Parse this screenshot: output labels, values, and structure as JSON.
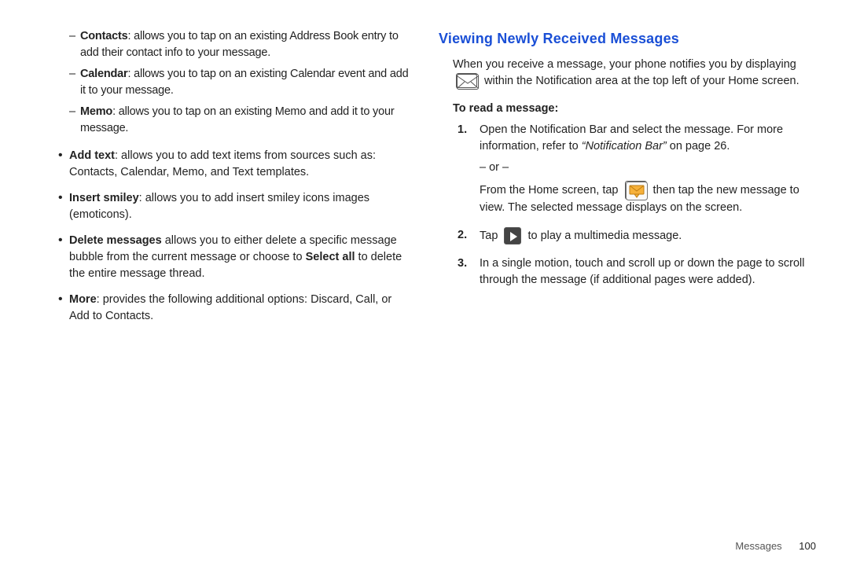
{
  "left": {
    "dash": [
      {
        "term": "Contacts",
        "text": ": allows you to tap on an existing Address Book entry to add their contact info to your message."
      },
      {
        "term": "Calendar",
        "text": ": allows you to tap on an existing Calendar event and add it to your message."
      },
      {
        "term": "Memo",
        "text": ": allows you to tap on an existing Memo and add it to your message."
      }
    ],
    "bullets": [
      {
        "term": "Add text",
        "text": ": allows you to add text items from sources such as: Contacts, Calendar, Memo, and Text templates."
      },
      {
        "term": "Insert smiley",
        "text": ": allows you to add insert smiley icons images (emoticons)."
      },
      {
        "term": "Delete messages",
        "pre": " allows you to either delete a specific message bubble from the current message or choose to ",
        "term2": "Select all",
        "text": " to delete the entire message thread."
      },
      {
        "term": "More",
        "text": ": provides the following additional options: Discard, Call, or Add to Contacts."
      }
    ]
  },
  "right": {
    "section_title": "Viewing Newly Received Messages",
    "intro_pre": "When you receive a message, your phone notifies you by displaying ",
    "intro_post": " within the Notification area at the top left of your Home screen.",
    "subhead": "To read a message:",
    "step1_a": "Open the Notification Bar and select the message. For more information, refer to ",
    "step1_ref": "“Notification Bar”",
    "step1_b": "  on page 26.",
    "or": "– or –",
    "step1_c": "From the Home screen, tap ",
    "step1_d": " then tap the new message to view. The selected message displays on the screen.",
    "step2_a": "Tap ",
    "step2_b": " to play a multimedia message.",
    "step3": "In a single motion, touch and scroll up or down the page to scroll through the message (if additional pages were added).",
    "nums": {
      "n1": "1.",
      "n2": "2.",
      "n3": "3."
    }
  },
  "footer": {
    "section": "Messages",
    "page": "100"
  }
}
